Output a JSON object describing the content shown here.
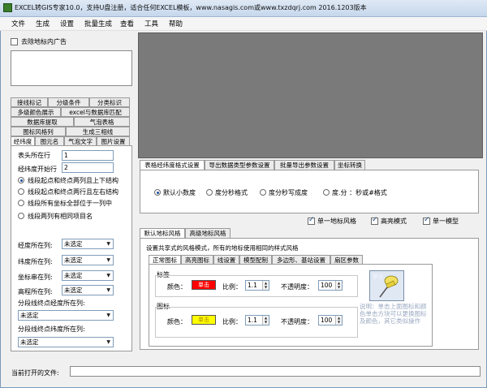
{
  "window": {
    "title": "EXCEL转GIS专家10.0，支持U盘注册，适合任何EXCEL模板，www.nasagis.com或www.txzdqrj.com 2016.1203版本"
  },
  "menu": [
    "文件",
    "生成",
    "设置",
    "批量生成",
    "查看",
    "工具",
    "帮助"
  ],
  "left": {
    "remove_ad_label": "去除地标内广告",
    "tab_rows": [
      [
        "接线标记",
        "分级条件",
        "分类标识"
      ],
      [
        "多级颜色展示",
        "excel与数据库匹配"
      ],
      [
        "数据库提取",
        "气泡表格"
      ],
      [
        "图标风格列",
        "生成三相线"
      ],
      [
        "经纬度",
        "图元名",
        "气泡文字",
        "图片设置"
      ]
    ],
    "header_row_label": "表头所在行",
    "header_row_value": "1",
    "start_row_label": "经纬度开始行",
    "start_row_value": "2",
    "radios": [
      "线段起点和终点两列且上下结构",
      "线段起点和终点两行且左右结构",
      "线段所有坐标全部位于一列中",
      "线段两列有相同项目名"
    ],
    "fields": [
      {
        "label": "经度所在列:",
        "value": "未选定"
      },
      {
        "label": "纬度所在列:",
        "value": "未选定"
      },
      {
        "label": "坐标串在列:",
        "value": "未选定"
      },
      {
        "label": "高程所在列:",
        "value": "未选定"
      }
    ],
    "seg_lon_label": "分段线终点经度所在列:",
    "seg_lon_value": "未选定",
    "seg_lat_label": "分段线终点纬度所在列:",
    "seg_lat_value": "未选定"
  },
  "right": {
    "top_tabs": [
      "表格经纬度格式设置",
      "导出数据类型参数设置",
      "批量导出参数设置",
      "坐标转换"
    ],
    "format_radios": [
      "默认小数度",
      "度分秒格式",
      "度分秒写成度",
      "度.分 ：秒或#格式"
    ],
    "checks": [
      "单一地标风格",
      "高亮模式",
      "单一模型"
    ],
    "style_tabs": [
      "默认地标风格",
      "高级地标风格"
    ],
    "shared_style_text": "设置共享式的风格模式，所有的地标使用相同的样式风格",
    "inner_tabs": [
      "正常图标",
      "高亮图标",
      "线设置",
      "模型配制",
      "多边形、基站设置",
      "扇区参数"
    ],
    "label_group": "标签",
    "icon_group": "图标",
    "color_label": "颜色：",
    "ratio_label": "比例：",
    "opacity_label": "不透明度：",
    "label_color_btn": "单击",
    "icon_color_btn": "单击",
    "label_scale": "1.1",
    "label_opacity": "100",
    "icon_scale": "1.1",
    "icon_opacity": "100",
    "pin_caption": "单击",
    "hint": "说明：单击上面图标和颜色单击方块可以更换图标及颜色，其它类似操作"
  },
  "status": {
    "current_file_label": "当前打开的文件:"
  },
  "colors": {
    "label_color": "#ff0000",
    "icon_color": "#ffff00",
    "pin_yellow": "#f2e060"
  }
}
